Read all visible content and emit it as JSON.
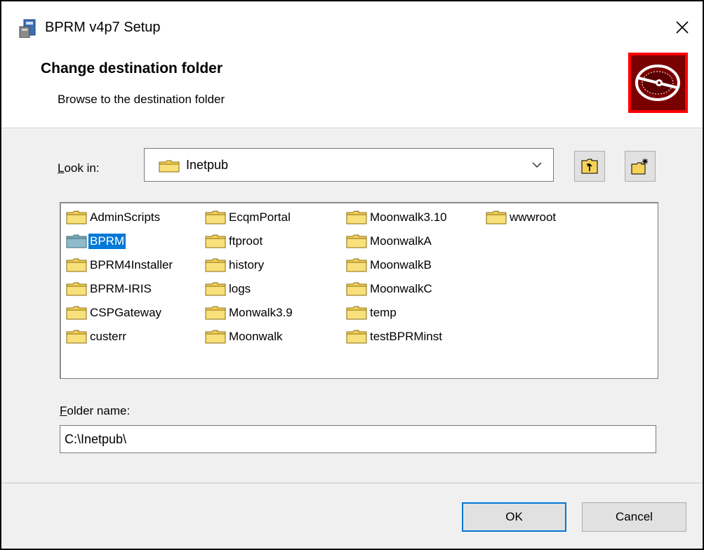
{
  "window": {
    "title": "BPRM v4p7 Setup"
  },
  "header": {
    "title": "Change destination folder",
    "subtitle": "Browse to the destination folder"
  },
  "lookin": {
    "label_accel": "L",
    "label_rest": "ook in:",
    "value": "Inetpub"
  },
  "files": [
    {
      "label": "AdminScripts",
      "selected": false
    },
    {
      "label": "BPRM",
      "selected": true
    },
    {
      "label": "BPRM4Installer",
      "selected": false
    },
    {
      "label": "BPRM-IRIS",
      "selected": false
    },
    {
      "label": "CSPGateway",
      "selected": false
    },
    {
      "label": "custerr",
      "selected": false
    },
    {
      "label": "EcqmPortal",
      "selected": false
    },
    {
      "label": "ftproot",
      "selected": false
    },
    {
      "label": "history",
      "selected": false
    },
    {
      "label": "logs",
      "selected": false
    },
    {
      "label": "Monwalk3.9",
      "selected": false
    },
    {
      "label": "Moonwalk",
      "selected": false
    },
    {
      "label": "Moonwalk3.10",
      "selected": false
    },
    {
      "label": "MoonwalkA",
      "selected": false
    },
    {
      "label": "MoonwalkB",
      "selected": false
    },
    {
      "label": "MoonwalkC",
      "selected": false
    },
    {
      "label": "temp",
      "selected": false
    },
    {
      "label": "testBPRMinst",
      "selected": false
    },
    {
      "label": "wwwroot",
      "selected": false
    }
  ],
  "folder_name": {
    "label_accel": "F",
    "label_rest": "older name:",
    "value": "C:\\Inetpub\\"
  },
  "buttons": {
    "ok": "OK",
    "cancel": "Cancel"
  },
  "colors": {
    "selection": "#0078d7",
    "logo_bg": "#7a0000",
    "logo_border": "#ff0000",
    "folder": "#f5d35a"
  }
}
